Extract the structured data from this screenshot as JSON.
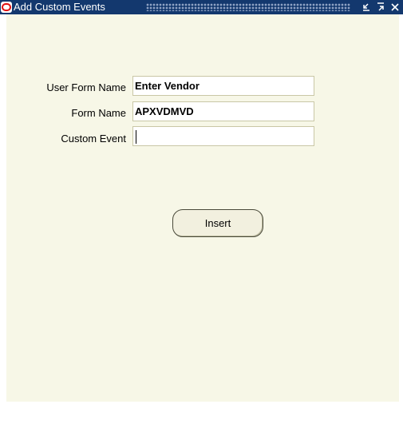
{
  "window": {
    "title": "Add Custom Events",
    "controls": {
      "minimize": "⌄",
      "maximize": "⌃",
      "close": "×"
    }
  },
  "form": {
    "user_form_name": {
      "label": "User Form Name",
      "value": "Enter Vendor"
    },
    "form_name": {
      "label": "Form Name",
      "value": "APXVDMVD"
    },
    "custom_event": {
      "label": "Custom Event",
      "value": ""
    }
  },
  "actions": {
    "insert_label": "Insert"
  },
  "colors": {
    "titlebar": "#13386e",
    "background": "#f7f7e7",
    "field_border": "#c9c7a6",
    "logo_red": "#e01010"
  },
  "icons": {
    "app": "oracle-logo-icon"
  }
}
